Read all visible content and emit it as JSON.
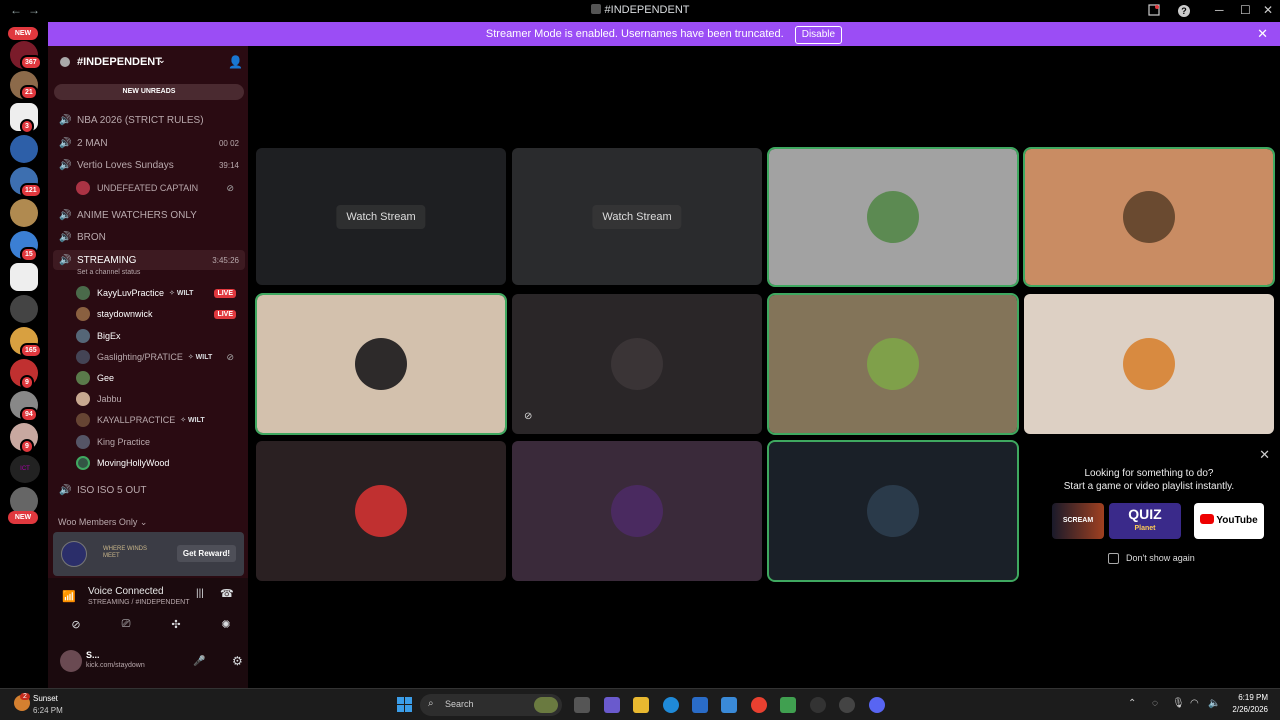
{
  "window": {
    "title": "#INDEPENDENT",
    "back": "←",
    "forward": "→",
    "minimize": "─",
    "maximize": "☐",
    "close": "✕",
    "help": "?"
  },
  "banner": {
    "text": "Streamer Mode is enabled. Usernames have been truncated.",
    "disable": "Disable",
    "close": "✕"
  },
  "servers": {
    "badges": [
      "367",
      "21",
      "3",
      "121",
      "15",
      "165",
      "9",
      "94",
      "9"
    ],
    "new_top": "NEW",
    "new_bottom": "NEW",
    "folder_label": "ICT"
  },
  "sidebar": {
    "server_name": "#INDEPENDENT",
    "new_unreads": "NEW UNREADS",
    "channels": [
      {
        "name": "NBA 2026 (STRICT RULES)",
        "right": ""
      },
      {
        "name": "2 MAN",
        "right": "00  02"
      },
      {
        "name": "Vertio Loves Sundays",
        "right": "39:14"
      },
      {
        "name": "ANIME WATCHERS ONLY",
        "right": ""
      },
      {
        "name": "BRON",
        "right": ""
      },
      {
        "name": "STREAMING",
        "right": "3:45:26"
      },
      {
        "name": "ISO ISO 5 OUT",
        "right": ""
      }
    ],
    "vertio_user": "UNDEFEATED CAPTAIN",
    "streaming_status": "Set a channel status",
    "streaming_users": [
      {
        "name": "KayyLuvPractice",
        "tag": "✧ WILT",
        "live": "LIVE"
      },
      {
        "name": "staydownwick",
        "tag": "",
        "live": "LIVE"
      },
      {
        "name": "BigEx",
        "tag": "",
        "live": ""
      },
      {
        "name": "Gaslighting/PRATICE",
        "tag": "✧ WILT",
        "live": ""
      },
      {
        "name": "Gee",
        "tag": "",
        "live": ""
      },
      {
        "name": "Jabbu",
        "tag": "",
        "live": ""
      },
      {
        "name": "KAYALLPRACTICE",
        "tag": "✧ WILT",
        "live": ""
      },
      {
        "name": "King Practice",
        "tag": "",
        "live": ""
      },
      {
        "name": "MovingHollyWood",
        "tag": "",
        "live": ""
      }
    ],
    "category": "Woo Members Only",
    "promo": {
      "brand": "WHERE WINDS MEET",
      "button": "Get Reward!"
    },
    "voice": {
      "status": "Voice Connected",
      "channel": "STREAMING / #INDEPENDENT"
    },
    "user": {
      "name": "S...",
      "activity": "kick.com/staydown"
    }
  },
  "stage": {
    "watch_label": "Watch Stream",
    "suggest": {
      "title_line1": "Looking for something to do?",
      "title_line2": "Start a game or video playlist instantly.",
      "dont_show": "Don't show again",
      "youtube": "YouTube",
      "quiz": "QUIZ",
      "quiz_sub": "Planet",
      "scream": "SCREAM"
    }
  },
  "taskbar": {
    "weather_badge": "2",
    "weather_label": "Sunset",
    "weather_time": "6:24 PM",
    "search": "Search",
    "time": "6:19 PM",
    "date": "2/26/2026"
  },
  "colors": {
    "accent": "#9b4df5",
    "live": "#e0383e",
    "speaking": "#3fa860",
    "sidebar": "#2a0b12"
  }
}
